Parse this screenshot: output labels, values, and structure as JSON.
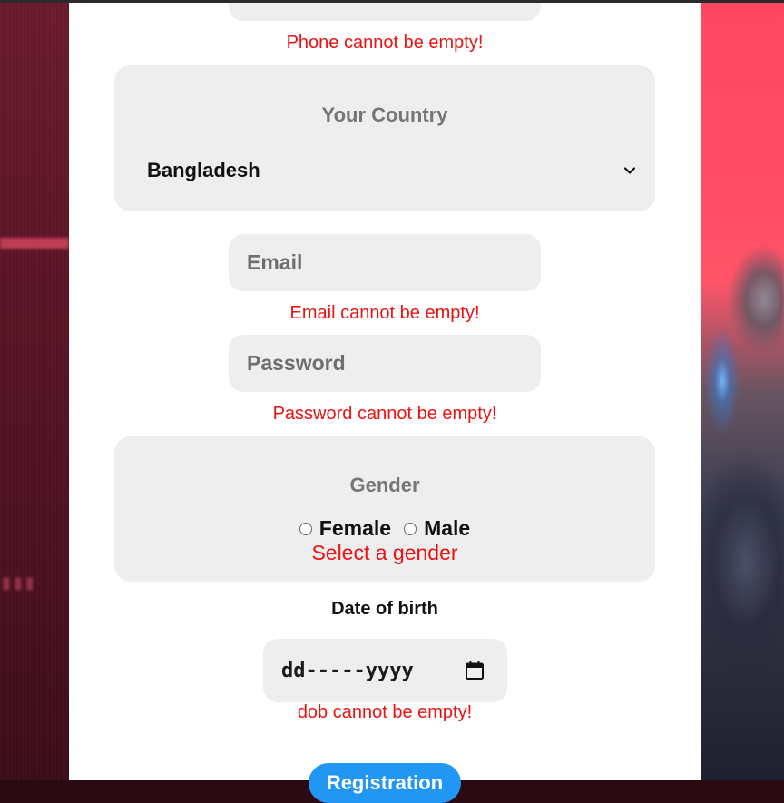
{
  "phone": {
    "error": "Phone cannot be empty!"
  },
  "country": {
    "title": "Your Country",
    "selected": "Bangladesh"
  },
  "email": {
    "placeholder": "Email",
    "error": "Email cannot be empty!"
  },
  "password": {
    "placeholder": "Password",
    "error": "Password cannot be empty!"
  },
  "gender": {
    "title": "Gender",
    "options": [
      "Female",
      "Male"
    ],
    "error": "Select a gender"
  },
  "dob": {
    "label": "Date of birth",
    "placeholder": "dd-----yyyy",
    "error": "dob cannot be empty!"
  },
  "register": {
    "label": "Registration"
  },
  "colors": {
    "error": "#ee1111",
    "field_bg": "#eeeeee",
    "button": "#2196f3"
  },
  "icons": {
    "select": "chevron-down-icon",
    "date": "calendar-icon"
  }
}
